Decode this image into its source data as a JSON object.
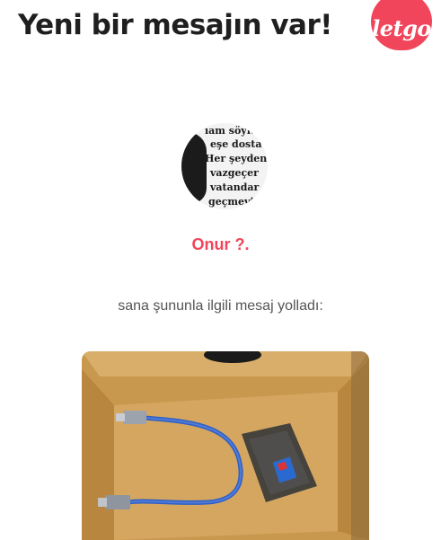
{
  "header": {
    "title": "Yeni bir mesajın var!",
    "logo_text": "letgo",
    "logo_color": "#f0455a"
  },
  "sender": {
    "avatar_icon": "user-avatar-photo",
    "avatar_text_lines": [
      "ıam söyle",
      "eşe dosta",
      "Her şeyden",
      "vazgeçer",
      "vatandar",
      "geçmevi"
    ],
    "name": "Onur ?.",
    "name_color": "#f0455a"
  },
  "message": {
    "text": "sana şununla ilgili mesaj yolladı:"
  },
  "product": {
    "image_icon": "product-photo-usb-cable-box"
  }
}
